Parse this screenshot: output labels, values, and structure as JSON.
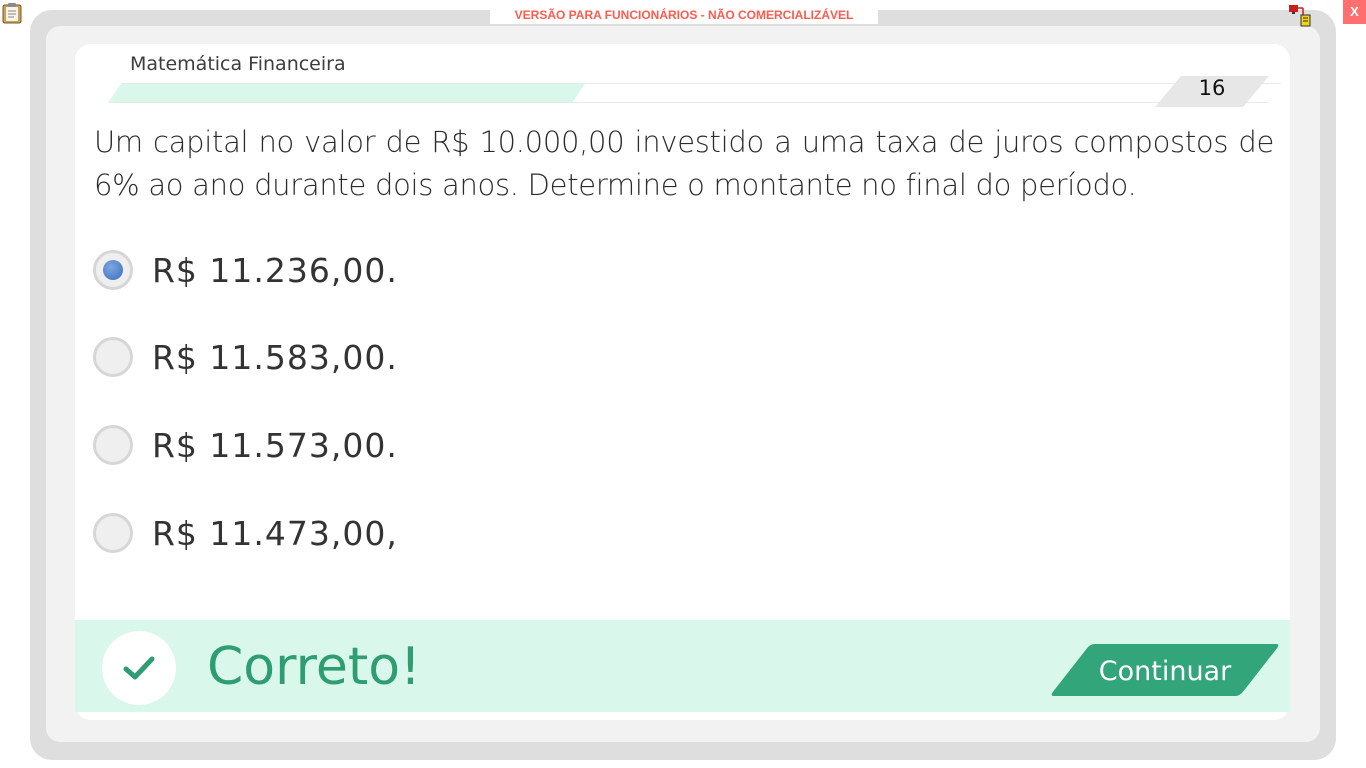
{
  "topbar": {
    "watermark": "VERSÃO PARA FUNCIONÁRIOS - NÃO COMERCIALIZÁVEL",
    "close_label": "X"
  },
  "header": {
    "subject": "Matemática Financeira",
    "question_number": "16",
    "progress": 0.4
  },
  "question": {
    "text": "Um capital no valor de R$ 10.000,00 investido a uma taxa de juros compostos de 6% ao ano durante dois anos. Determine o montante no final do período."
  },
  "options": [
    {
      "label": "R$ 11.236,00.",
      "selected": true
    },
    {
      "label": "R$ 11.583,00.",
      "selected": false
    },
    {
      "label": "R$ 11.573,00.",
      "selected": false
    },
    {
      "label": "R$ 11.473,00,",
      "selected": false
    }
  ],
  "feedback": {
    "status": "Correto!",
    "continue_label": "Continuar"
  },
  "colors": {
    "accent": "#32a57a",
    "feedback_bg": "#d9f7ea",
    "watermark": "#ff5a4e",
    "close": "#ff6f6f"
  },
  "icons": [
    "clipboard-icon",
    "network-icon",
    "check-icon"
  ]
}
